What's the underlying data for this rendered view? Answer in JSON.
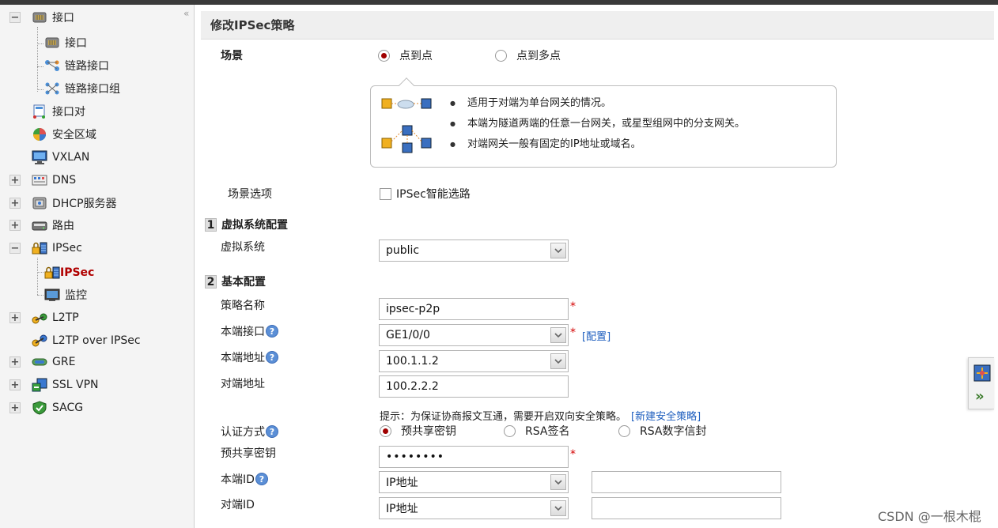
{
  "sidebar": {
    "items": [
      {
        "label": "接口",
        "expander": "minus",
        "icon": "interface-icon"
      },
      {
        "label": "接口",
        "icon": "interface-icon"
      },
      {
        "label": "链路接口",
        "icon": "link-interface-icon"
      },
      {
        "label": "链路接口组",
        "icon": "link-interface-group-icon"
      },
      {
        "label": "接口对",
        "icon": "interface-pair-icon"
      },
      {
        "label": "安全区域",
        "icon": "security-zone-icon"
      },
      {
        "label": "VXLAN",
        "icon": "vxlan-icon"
      },
      {
        "label": "DNS",
        "expander": "plus",
        "icon": "dns-icon"
      },
      {
        "label": "DHCP服务器",
        "expander": "plus",
        "icon": "dhcp-icon"
      },
      {
        "label": "路由",
        "expander": "plus",
        "icon": "router-icon"
      },
      {
        "label": "IPSec",
        "expander": "minus",
        "icon": "ipsec-icon"
      },
      {
        "label": "IPSec",
        "icon": "ipsec-icon",
        "active": true
      },
      {
        "label": "监控",
        "icon": "monitor-icon"
      },
      {
        "label": "L2TP",
        "expander": "plus",
        "icon": "l2tp-icon"
      },
      {
        "label": "L2TP over IPSec",
        "icon": "l2tp-ipsec-icon"
      },
      {
        "label": "GRE",
        "expander": "plus",
        "icon": "gre-icon"
      },
      {
        "label": "SSL VPN",
        "expander": "plus",
        "icon": "sslvpn-icon"
      },
      {
        "label": "SACG",
        "expander": "plus",
        "icon": "sacg-icon"
      }
    ]
  },
  "main": {
    "title": "修改IPSec策略",
    "scenario": {
      "label": "场景",
      "options": [
        "点到点",
        "点到多点"
      ],
      "selected": "点到点"
    },
    "tip": {
      "bullets": [
        "适用于对端为单台网关的情况。",
        "本端为隧道两端的任意一台网关，或星型组网中的分支网关。",
        "对端网关一般有固定的IP地址或域名。"
      ]
    },
    "scenario_options": {
      "label": "场景选项",
      "checkbox_label": "IPSec智能选路",
      "checked": false
    },
    "section1": {
      "num": "1",
      "title": "虚拟系统配置"
    },
    "vsys": {
      "label": "虚拟系统",
      "value": "public"
    },
    "section2": {
      "num": "2",
      "title": "基本配置"
    },
    "policy_name": {
      "label": "策略名称",
      "value": "ipsec-p2p",
      "required": "*"
    },
    "local_interface": {
      "label": "本端接口",
      "value": "GE1/0/0",
      "required": "*",
      "link": "[配置]"
    },
    "local_address": {
      "label": "本端地址",
      "value": "100.1.1.2"
    },
    "peer_address": {
      "label": "对端地址",
      "value": "100.2.2.2"
    },
    "hint": {
      "text": "提示：为保证协商报文互通，需要开启双向安全策略。",
      "link": "[新建安全策略]"
    },
    "auth": {
      "label": "认证方式",
      "options": [
        "预共享密钥",
        "RSA签名",
        "RSA数字信封"
      ],
      "selected": "预共享密钥"
    },
    "psk": {
      "label": "预共享密钥",
      "value": "••••••••",
      "required": "*"
    },
    "local_id": {
      "label": "本端ID",
      "value": "IP地址",
      "extra": ""
    },
    "peer_id": {
      "label": "对端ID",
      "value": "IP地址",
      "extra": ""
    },
    "help_glyph": "?"
  },
  "side_panel": {
    "arrow": "»"
  },
  "watermark": "CSDN @一根木棍",
  "collapse_glyph": "«",
  "colors": {
    "accent_red": "#a00000",
    "link_blue": "#1f5fbf",
    "help_blue": "#5b8fd6"
  }
}
